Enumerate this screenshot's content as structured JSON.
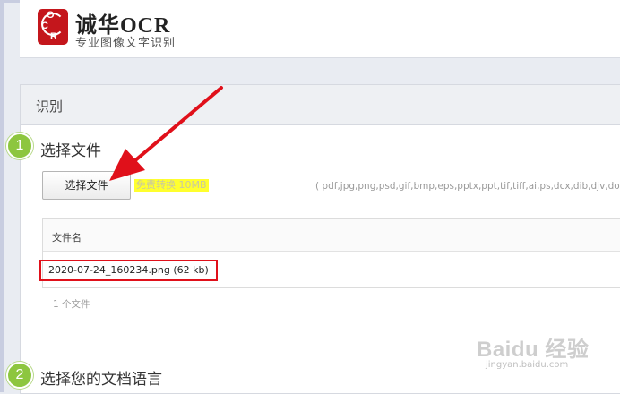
{
  "brand": {
    "logo_letters": [
      "O",
      "C",
      "R"
    ],
    "name": "诚华OCR",
    "tagline": "专业图像文字识别"
  },
  "panel": {
    "title": "识别"
  },
  "step1": {
    "number": "1",
    "title": "选择文件",
    "choose_button": "选择文件",
    "free_note": "免费转换 10MB",
    "formats": "( pdf,jpg,png,psd,gif,bmp,eps,pptx,ppt,tif,tiff,ai,ps,dcx,dib,djv,do"
  },
  "file_table": {
    "column_header": "文件名",
    "files": [
      {
        "name": "2020-07-24_160234.png (62 kb)"
      }
    ],
    "count_text": "1 个文件"
  },
  "step2": {
    "number": "2",
    "title": "选择您的文档语言"
  },
  "watermark": {
    "main": "Baidu 经验",
    "sub": "jingyan.baidu.com"
  },
  "colors": {
    "logo_red": "#c4161c",
    "step_green": "#8dc63f",
    "highlight_yellow": "#ffff2e",
    "annotation_red": "#e0101a"
  }
}
